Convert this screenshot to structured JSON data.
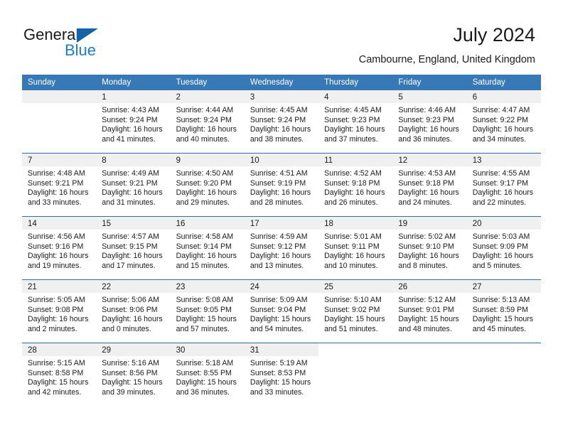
{
  "brand": {
    "word1": "General",
    "word2": "Blue",
    "flag_color": "#1463a8",
    "blue_color": "#1d7dc4"
  },
  "header": {
    "month_title": "July 2024",
    "location": "Cambourne, England, United Kingdom"
  },
  "theme": {
    "header_row_bg": "#3679b6",
    "week_divider": "#2e6da4",
    "day_band_bg": "#f0f0f0"
  },
  "weekdays": [
    "Sunday",
    "Monday",
    "Tuesday",
    "Wednesday",
    "Thursday",
    "Friday",
    "Saturday"
  ],
  "weeks": [
    [
      {
        "day": "",
        "lines": []
      },
      {
        "day": "1",
        "lines": [
          "Sunrise: 4:43 AM",
          "Sunset: 9:24 PM",
          "Daylight: 16 hours",
          "and 41 minutes."
        ]
      },
      {
        "day": "2",
        "lines": [
          "Sunrise: 4:44 AM",
          "Sunset: 9:24 PM",
          "Daylight: 16 hours",
          "and 40 minutes."
        ]
      },
      {
        "day": "3",
        "lines": [
          "Sunrise: 4:45 AM",
          "Sunset: 9:24 PM",
          "Daylight: 16 hours",
          "and 38 minutes."
        ]
      },
      {
        "day": "4",
        "lines": [
          "Sunrise: 4:45 AM",
          "Sunset: 9:23 PM",
          "Daylight: 16 hours",
          "and 37 minutes."
        ]
      },
      {
        "day": "5",
        "lines": [
          "Sunrise: 4:46 AM",
          "Sunset: 9:23 PM",
          "Daylight: 16 hours",
          "and 36 minutes."
        ]
      },
      {
        "day": "6",
        "lines": [
          "Sunrise: 4:47 AM",
          "Sunset: 9:22 PM",
          "Daylight: 16 hours",
          "and 34 minutes."
        ]
      }
    ],
    [
      {
        "day": "7",
        "lines": [
          "Sunrise: 4:48 AM",
          "Sunset: 9:21 PM",
          "Daylight: 16 hours",
          "and 33 minutes."
        ]
      },
      {
        "day": "8",
        "lines": [
          "Sunrise: 4:49 AM",
          "Sunset: 9:21 PM",
          "Daylight: 16 hours",
          "and 31 minutes."
        ]
      },
      {
        "day": "9",
        "lines": [
          "Sunrise: 4:50 AM",
          "Sunset: 9:20 PM",
          "Daylight: 16 hours",
          "and 29 minutes."
        ]
      },
      {
        "day": "10",
        "lines": [
          "Sunrise: 4:51 AM",
          "Sunset: 9:19 PM",
          "Daylight: 16 hours",
          "and 28 minutes."
        ]
      },
      {
        "day": "11",
        "lines": [
          "Sunrise: 4:52 AM",
          "Sunset: 9:18 PM",
          "Daylight: 16 hours",
          "and 26 minutes."
        ]
      },
      {
        "day": "12",
        "lines": [
          "Sunrise: 4:53 AM",
          "Sunset: 9:18 PM",
          "Daylight: 16 hours",
          "and 24 minutes."
        ]
      },
      {
        "day": "13",
        "lines": [
          "Sunrise: 4:55 AM",
          "Sunset: 9:17 PM",
          "Daylight: 16 hours",
          "and 22 minutes."
        ]
      }
    ],
    [
      {
        "day": "14",
        "lines": [
          "Sunrise: 4:56 AM",
          "Sunset: 9:16 PM",
          "Daylight: 16 hours",
          "and 19 minutes."
        ]
      },
      {
        "day": "15",
        "lines": [
          "Sunrise: 4:57 AM",
          "Sunset: 9:15 PM",
          "Daylight: 16 hours",
          "and 17 minutes."
        ]
      },
      {
        "day": "16",
        "lines": [
          "Sunrise: 4:58 AM",
          "Sunset: 9:14 PM",
          "Daylight: 16 hours",
          "and 15 minutes."
        ]
      },
      {
        "day": "17",
        "lines": [
          "Sunrise: 4:59 AM",
          "Sunset: 9:12 PM",
          "Daylight: 16 hours",
          "and 13 minutes."
        ]
      },
      {
        "day": "18",
        "lines": [
          "Sunrise: 5:01 AM",
          "Sunset: 9:11 PM",
          "Daylight: 16 hours",
          "and 10 minutes."
        ]
      },
      {
        "day": "19",
        "lines": [
          "Sunrise: 5:02 AM",
          "Sunset: 9:10 PM",
          "Daylight: 16 hours",
          "and 8 minutes."
        ]
      },
      {
        "day": "20",
        "lines": [
          "Sunrise: 5:03 AM",
          "Sunset: 9:09 PM",
          "Daylight: 16 hours",
          "and 5 minutes."
        ]
      }
    ],
    [
      {
        "day": "21",
        "lines": [
          "Sunrise: 5:05 AM",
          "Sunset: 9:08 PM",
          "Daylight: 16 hours",
          "and 2 minutes."
        ]
      },
      {
        "day": "22",
        "lines": [
          "Sunrise: 5:06 AM",
          "Sunset: 9:06 PM",
          "Daylight: 16 hours",
          "and 0 minutes."
        ]
      },
      {
        "day": "23",
        "lines": [
          "Sunrise: 5:08 AM",
          "Sunset: 9:05 PM",
          "Daylight: 15 hours",
          "and 57 minutes."
        ]
      },
      {
        "day": "24",
        "lines": [
          "Sunrise: 5:09 AM",
          "Sunset: 9:04 PM",
          "Daylight: 15 hours",
          "and 54 minutes."
        ]
      },
      {
        "day": "25",
        "lines": [
          "Sunrise: 5:10 AM",
          "Sunset: 9:02 PM",
          "Daylight: 15 hours",
          "and 51 minutes."
        ]
      },
      {
        "day": "26",
        "lines": [
          "Sunrise: 5:12 AM",
          "Sunset: 9:01 PM",
          "Daylight: 15 hours",
          "and 48 minutes."
        ]
      },
      {
        "day": "27",
        "lines": [
          "Sunrise: 5:13 AM",
          "Sunset: 8:59 PM",
          "Daylight: 15 hours",
          "and 45 minutes."
        ]
      }
    ],
    [
      {
        "day": "28",
        "lines": [
          "Sunrise: 5:15 AM",
          "Sunset: 8:58 PM",
          "Daylight: 15 hours",
          "and 42 minutes."
        ]
      },
      {
        "day": "29",
        "lines": [
          "Sunrise: 5:16 AM",
          "Sunset: 8:56 PM",
          "Daylight: 15 hours",
          "and 39 minutes."
        ]
      },
      {
        "day": "30",
        "lines": [
          "Sunrise: 5:18 AM",
          "Sunset: 8:55 PM",
          "Daylight: 15 hours",
          "and 36 minutes."
        ]
      },
      {
        "day": "31",
        "lines": [
          "Sunrise: 5:19 AM",
          "Sunset: 8:53 PM",
          "Daylight: 15 hours",
          "and 33 minutes."
        ]
      },
      {
        "day": "",
        "lines": []
      },
      {
        "day": "",
        "lines": []
      },
      {
        "day": "",
        "lines": []
      }
    ]
  ]
}
